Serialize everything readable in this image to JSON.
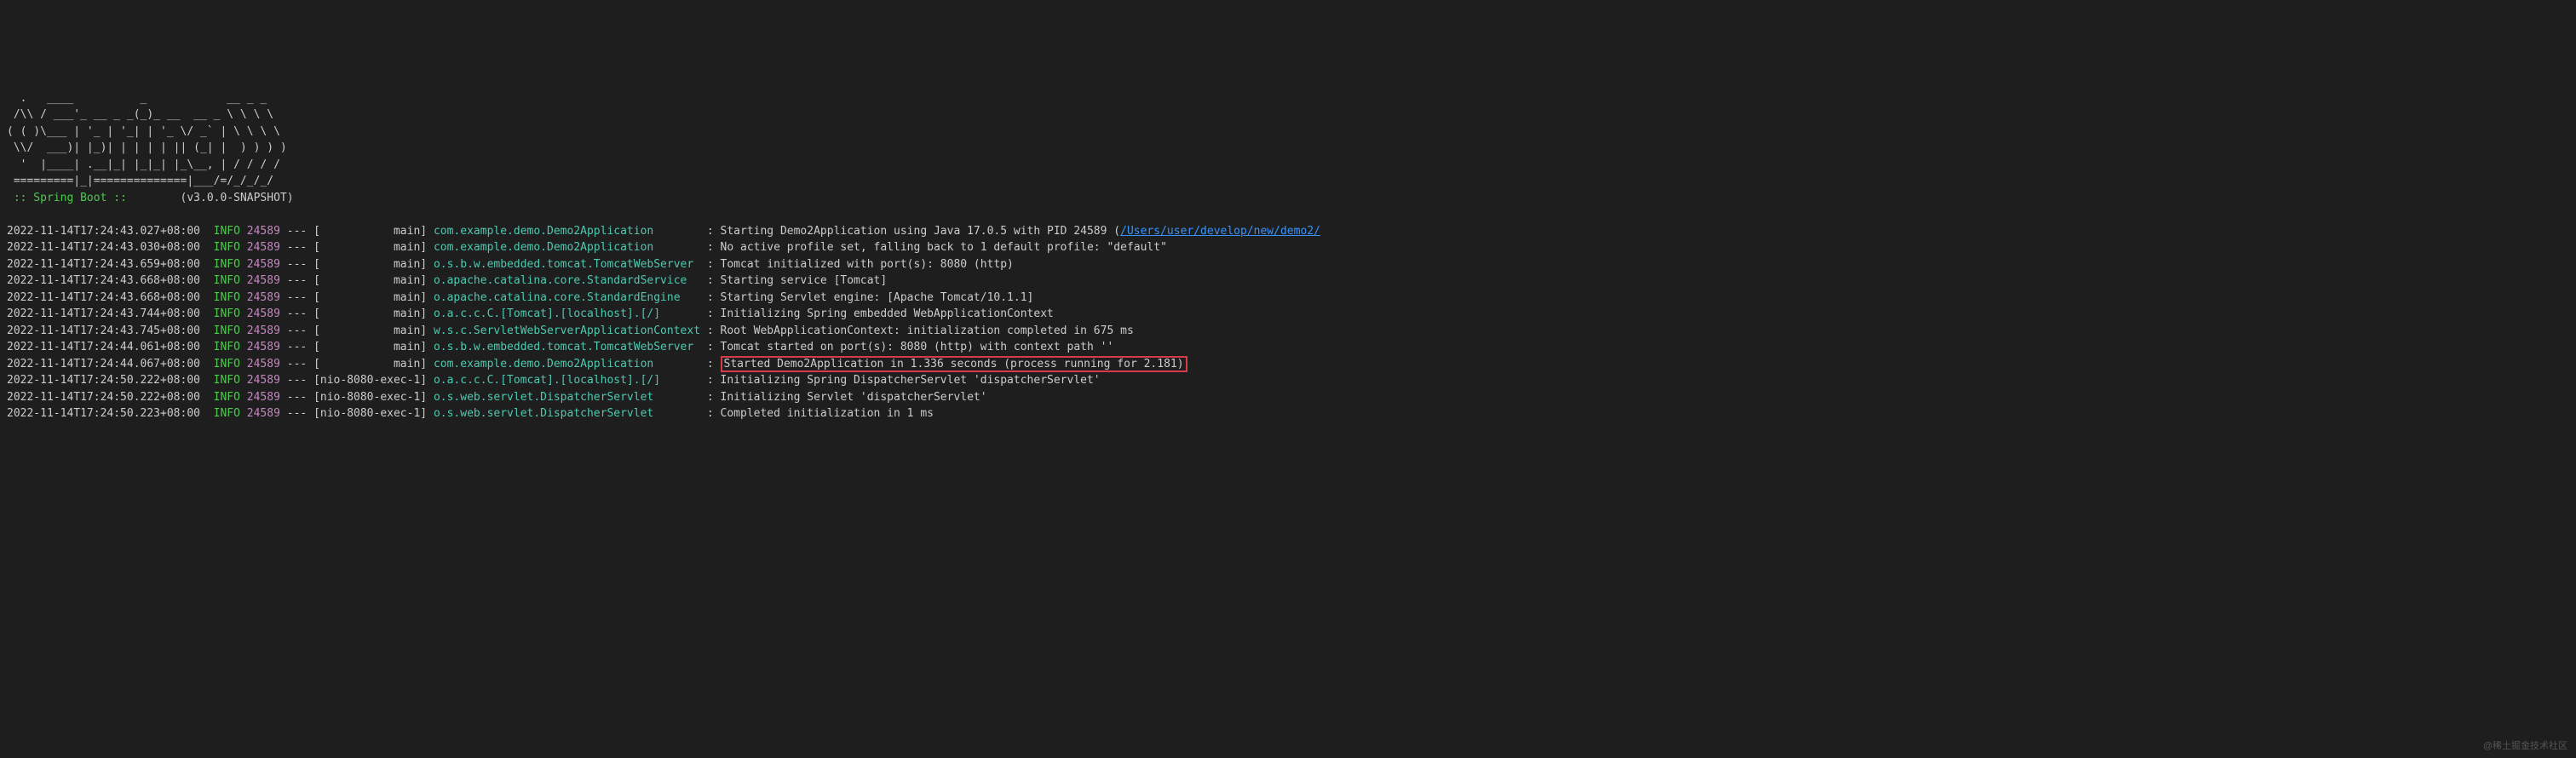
{
  "banner": {
    "lines": [
      "  .   ____          _            __ _ _",
      " /\\\\ / ___'_ __ _ _(_)_ __  __ _ \\ \\ \\ \\",
      "( ( )\\___ | '_ | '_| | '_ \\/ _` | \\ \\ \\ \\",
      " \\\\/  ___)| |_)| | | | | || (_| |  ) ) ) )",
      "  '  |____| .__|_| |_|_| |_\\__, | / / / /",
      " =========|_|==============|___/=/_/_/_/"
    ],
    "label": " :: Spring Boot :: ",
    "version": "(v3.0.0-SNAPSHOT)"
  },
  "logs": [
    {
      "ts": "2022-11-14T17:24:43.027+08:00",
      "level": "INFO",
      "pid": "24589",
      "thread": "main",
      "logger": "com.example.demo.Demo2Application",
      "msg": "Starting Demo2Application using Java 17.0.5 with PID 24589 (",
      "link": "/Users/user/develop/new/demo2/",
      "highlighted": false
    },
    {
      "ts": "2022-11-14T17:24:43.030+08:00",
      "level": "INFO",
      "pid": "24589",
      "thread": "main",
      "logger": "com.example.demo.Demo2Application",
      "msg": "No active profile set, falling back to 1 default profile: \"default\"",
      "highlighted": false
    },
    {
      "ts": "2022-11-14T17:24:43.659+08:00",
      "level": "INFO",
      "pid": "24589",
      "thread": "main",
      "logger": "o.s.b.w.embedded.tomcat.TomcatWebServer",
      "msg": "Tomcat initialized with port(s): 8080 (http)",
      "highlighted": false
    },
    {
      "ts": "2022-11-14T17:24:43.668+08:00",
      "level": "INFO",
      "pid": "24589",
      "thread": "main",
      "logger": "o.apache.catalina.core.StandardService",
      "msg": "Starting service [Tomcat]",
      "highlighted": false
    },
    {
      "ts": "2022-11-14T17:24:43.668+08:00",
      "level": "INFO",
      "pid": "24589",
      "thread": "main",
      "logger": "o.apache.catalina.core.StandardEngine",
      "msg": "Starting Servlet engine: [Apache Tomcat/10.1.1]",
      "highlighted": false
    },
    {
      "ts": "2022-11-14T17:24:43.744+08:00",
      "level": "INFO",
      "pid": "24589",
      "thread": "main",
      "logger": "o.a.c.c.C.[Tomcat].[localhost].[/]",
      "msg": "Initializing Spring embedded WebApplicationContext",
      "highlighted": false
    },
    {
      "ts": "2022-11-14T17:24:43.745+08:00",
      "level": "INFO",
      "pid": "24589",
      "thread": "main",
      "logger": "w.s.c.ServletWebServerApplicationContext",
      "msg": "Root WebApplicationContext: initialization completed in 675 ms",
      "highlighted": false
    },
    {
      "ts": "2022-11-14T17:24:44.061+08:00",
      "level": "INFO",
      "pid": "24589",
      "thread": "main",
      "logger": "o.s.b.w.embedded.tomcat.TomcatWebServer",
      "msg": "Tomcat started on port(s): 8080 (http) with context path ''",
      "highlighted": false
    },
    {
      "ts": "2022-11-14T17:24:44.067+08:00",
      "level": "INFO",
      "pid": "24589",
      "thread": "main",
      "logger": "com.example.demo.Demo2Application",
      "msg": "Started Demo2Application in 1.336 seconds (process running for 2.181)",
      "highlighted": true
    },
    {
      "ts": "2022-11-14T17:24:50.222+08:00",
      "level": "INFO",
      "pid": "24589",
      "thread": "nio-8080-exec-1",
      "logger": "o.a.c.c.C.[Tomcat].[localhost].[/]",
      "msg": "Initializing Spring DispatcherServlet 'dispatcherServlet'",
      "highlighted": false
    },
    {
      "ts": "2022-11-14T17:24:50.222+08:00",
      "level": "INFO",
      "pid": "24589",
      "thread": "nio-8080-exec-1",
      "logger": "o.s.web.servlet.DispatcherServlet",
      "msg": "Initializing Servlet 'dispatcherServlet'",
      "highlighted": false
    },
    {
      "ts": "2022-11-14T17:24:50.223+08:00",
      "level": "INFO",
      "pid": "24589",
      "thread": "nio-8080-exec-1",
      "logger": "o.s.web.servlet.DispatcherServlet",
      "msg": "Completed initialization in 1 ms",
      "highlighted": false
    }
  ],
  "watermark": "@稀土掘金技术社区"
}
